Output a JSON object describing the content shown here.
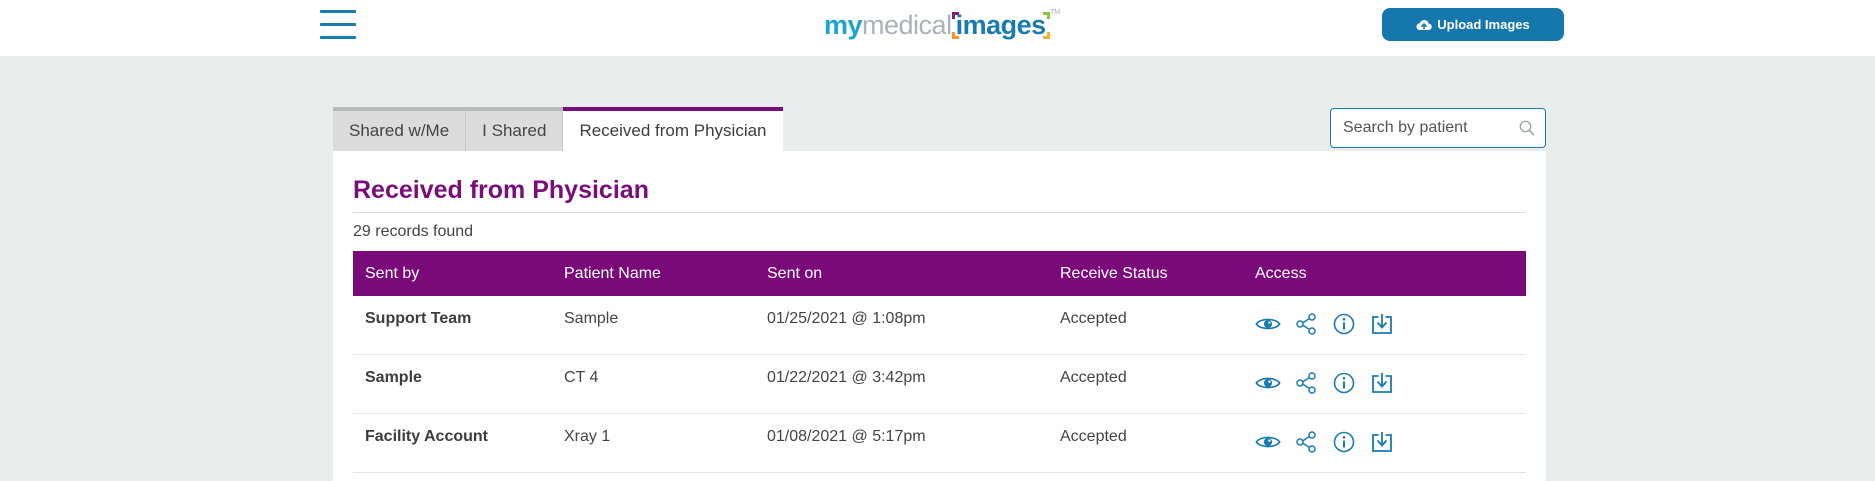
{
  "header": {
    "logo": {
      "part1": "my",
      "part2": "medical",
      "part3": "images",
      "tm": "TM"
    },
    "upload_label": "Upload Images",
    "icons": {
      "menu": "hamburger-menu-icon",
      "upload": "cloud-upload-icon"
    }
  },
  "tabs": [
    {
      "label": "Shared w/Me",
      "active": false
    },
    {
      "label": "I Shared",
      "active": false
    },
    {
      "label": "Received from Physician",
      "active": true
    }
  ],
  "search": {
    "placeholder": "Search by patient",
    "icon": "search-icon"
  },
  "panel": {
    "title": "Received from Physician",
    "record_count": "29 records found"
  },
  "table": {
    "columns": [
      "Sent by",
      "Patient Name",
      "Sent on",
      "Receive Status",
      "Access"
    ],
    "rows": [
      {
        "sent_by": "Support Team",
        "patient": "Sample",
        "sent_on": "01/25/2021 @ 1:08pm",
        "status": "Accepted"
      },
      {
        "sent_by": "Sample",
        "patient": "CT 4",
        "sent_on": "01/22/2021 @ 3:42pm",
        "status": "Accepted"
      },
      {
        "sent_by": "Facility Account",
        "patient": "Xray 1",
        "sent_on": "01/08/2021 @ 5:17pm",
        "status": "Accepted"
      }
    ],
    "access_icons": [
      "eye-icon",
      "share-icon",
      "info-icon",
      "download-icon"
    ]
  },
  "colors": {
    "brand_blue": "#1577ab",
    "accent_purple": "#7a0a7a",
    "page_bg": "#e8eded"
  }
}
